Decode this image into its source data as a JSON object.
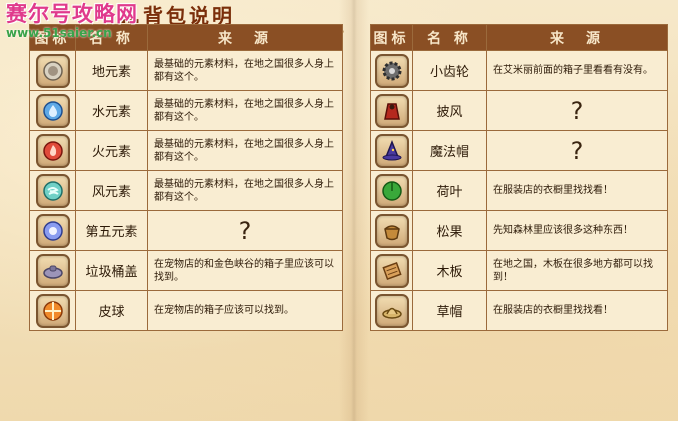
{
  "watermark": {
    "line1": "赛尔号攻略网",
    "line2": "www.51saier.cn"
  },
  "header": {
    "title": "…背包说明"
  },
  "left_table": {
    "headers": {
      "icon": "图标",
      "name": "名 称",
      "source": "来　源"
    },
    "rows": [
      {
        "icon": "earth-element-icon",
        "name": "地元素",
        "source": "最基础的元素材料，在地之国很多人身上都有这个。"
      },
      {
        "icon": "water-element-icon",
        "name": "水元素",
        "source": "最基础的元素材料，在地之国很多人身上都有这个。"
      },
      {
        "icon": "fire-element-icon",
        "name": "火元素",
        "source": "最基础的元素材料，在地之国很多人身上都有这个。"
      },
      {
        "icon": "wind-element-icon",
        "name": "风元素",
        "source": "最基础的元素材料，在地之国很多人身上都有这个。"
      },
      {
        "icon": "fifth-element-icon",
        "name": "第五元素",
        "source": "?"
      },
      {
        "icon": "trash-lid-icon",
        "name": "垃圾桶盖",
        "source": "在宠物店的和金色峡谷的箱子里应该可以找到。"
      },
      {
        "icon": "ball-icon",
        "name": "皮球",
        "source": "在宠物店的箱子应该可以找到。"
      }
    ]
  },
  "right_table": {
    "headers": {
      "icon": "图标",
      "name": "名 称",
      "source": "来　源"
    },
    "rows": [
      {
        "icon": "gear-icon",
        "name": "小齿轮",
        "source": "在艾米丽前面的箱子里看看有没有。"
      },
      {
        "icon": "cloak-icon",
        "name": "披风",
        "source": "?"
      },
      {
        "icon": "wizard-hat-icon",
        "name": "魔法帽",
        "source": "?"
      },
      {
        "icon": "lotus-leaf-icon",
        "name": "荷叶",
        "source": "在服装店的衣橱里找找看！"
      },
      {
        "icon": "pinecone-icon",
        "name": "松果",
        "source": "先知森林里应该很多这种东西！"
      },
      {
        "icon": "plank-icon",
        "name": "木板",
        "source": "在地之国，木板在很多地方都可以找到！"
      },
      {
        "icon": "straw-hat-icon",
        "name": "草帽",
        "source": "在服装店的衣橱里找找看！"
      }
    ]
  },
  "colors": {
    "header_bg": "#8a4f24",
    "page_bg": "#f3e3bf",
    "watermark_pink": "#e03a8c",
    "watermark_green": "#3aa34a"
  }
}
